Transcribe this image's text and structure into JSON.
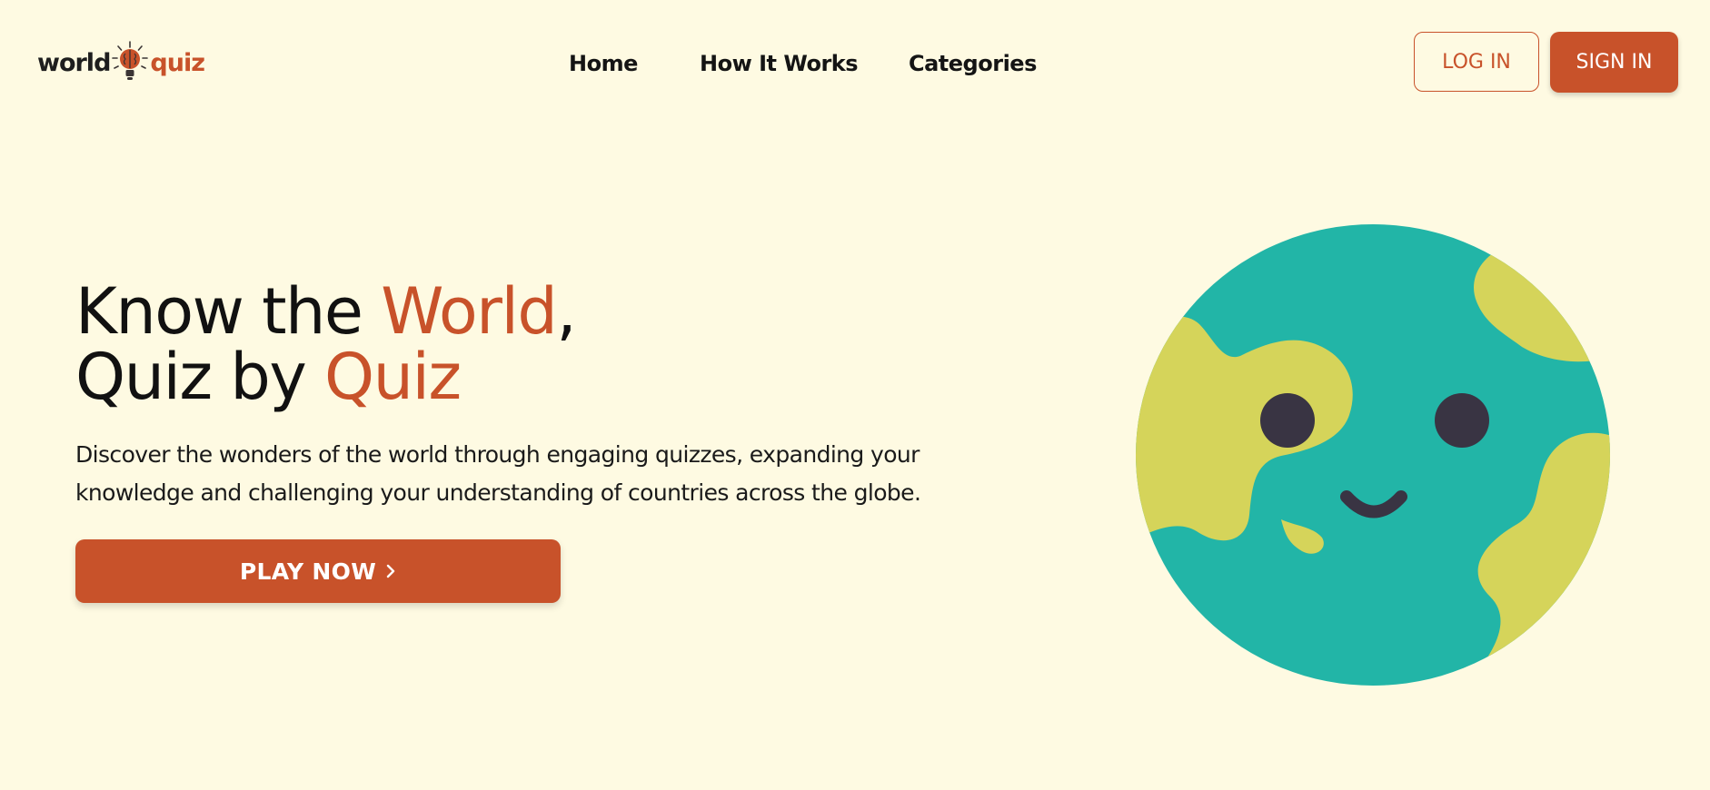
{
  "brand": {
    "word1": "world",
    "word2": "quiz",
    "icon": "lightbulb-brain-icon"
  },
  "nav": {
    "items": [
      {
        "label": "Home"
      },
      {
        "label": "How It Works"
      },
      {
        "label": "Categories"
      }
    ]
  },
  "auth": {
    "login_label": "LOG IN",
    "signin_label": "SIGN IN"
  },
  "hero": {
    "title_line1_pre": "Know the ",
    "title_line1_accent": "World",
    "title_line1_post": ",",
    "title_line2_pre": "Quiz by ",
    "title_line2_accent": "Quiz",
    "description": "Discover the wonders of the world through engaging quizzes, expanding your knowledge and challenging your understanding of countries across the globe.",
    "cta_label": "PLAY NOW",
    "cta_icon": "chevron-right-icon",
    "illustration": "smiling-globe-illustration"
  },
  "colors": {
    "background": "#FEFAE2",
    "accent": "#C8522A",
    "ocean": "#22B5A7",
    "land": "#D5D45A",
    "face": "#393443"
  }
}
